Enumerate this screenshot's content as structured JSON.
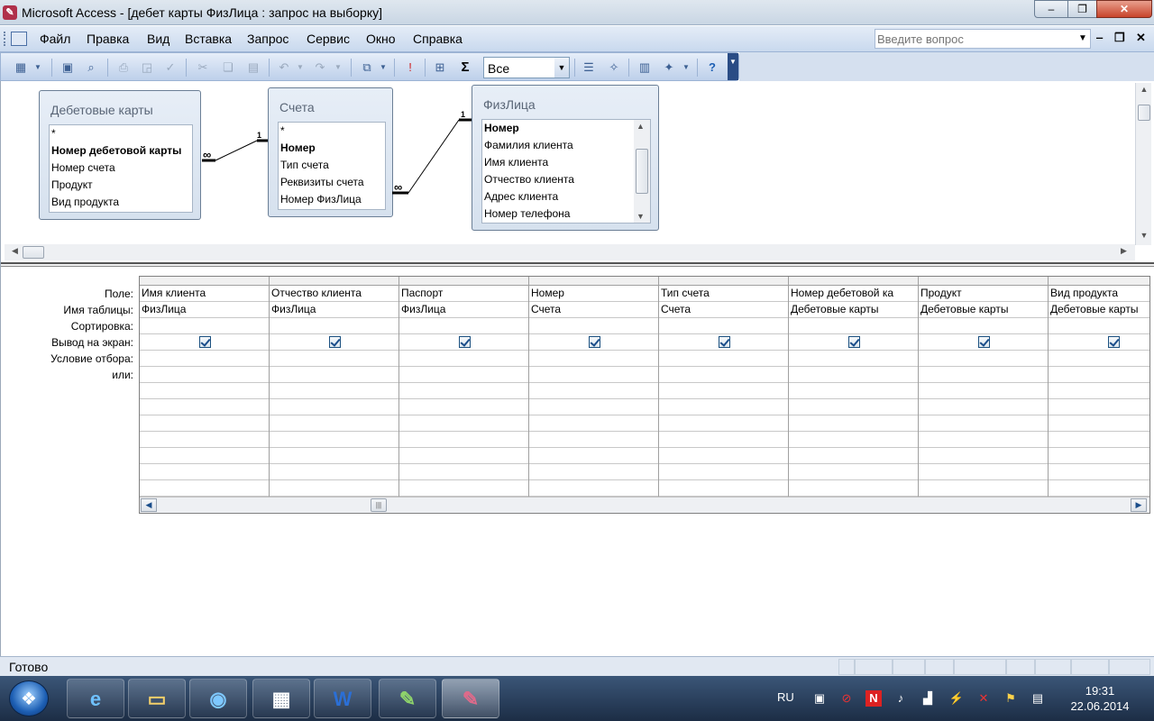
{
  "window": {
    "title": "Microsoft Access - [дебет карты ФизЛица : запрос на выборку]",
    "minimize_glyph": "‒",
    "maximize_glyph": "❐",
    "close_glyph": "✕"
  },
  "menu": {
    "items": [
      "Файл",
      "Правка",
      "Вид",
      "Вставка",
      "Запрос",
      "Сервис",
      "Окно",
      "Справка"
    ],
    "help_placeholder": "Введите вопрос",
    "mdi_minimize": "‒",
    "mdi_restore": "❐",
    "mdi_close": "✕"
  },
  "toolbar": {
    "top_values_combo": "Все",
    "totals_glyph": "Σ"
  },
  "tables": [
    {
      "name": "Дебетовые карты",
      "fields": [
        "*",
        "Номер дебетовой карты",
        "Номер счета",
        "Продукт",
        "Вид продукта"
      ],
      "key_index": 1
    },
    {
      "name": "Счета",
      "fields": [
        "*",
        "Номер",
        "Тип счета",
        "Реквизиты счета",
        "Номер ФизЛица"
      ],
      "key_index": 1
    },
    {
      "name": "ФизЛица",
      "fields": [
        "Номер",
        "Фамилия клиента",
        "Имя клиента",
        "Отчество клиента",
        "Адрес клиента",
        "Номер телефона"
      ],
      "key_index": 0
    }
  ],
  "relationships": {
    "one_label": "1",
    "many_label": "∞"
  },
  "qbe": {
    "row_labels": [
      "Поле:",
      "Имя таблицы:",
      "Сортировка:",
      "Вывод на экран:",
      "Условие отбора:",
      "или:"
    ],
    "columns": [
      {
        "field": "Имя клиента",
        "table": "ФизЛица",
        "show": true
      },
      {
        "field": "Отчество клиента",
        "table": "ФизЛица",
        "show": true
      },
      {
        "field": "Паспорт",
        "table": "ФизЛица",
        "show": true
      },
      {
        "field": "Номер",
        "table": "Счета",
        "show": true
      },
      {
        "field": "Тип счета",
        "table": "Счета",
        "show": true
      },
      {
        "field": "Номер дебетовой ка",
        "table": "Дебетовые карты",
        "show": true
      },
      {
        "field": "Продукт",
        "table": "Дебетовые карты",
        "show": true
      },
      {
        "field": "Вид продукта",
        "table": "Дебетовые карты",
        "show": true
      }
    ]
  },
  "status": {
    "text": "Готово"
  },
  "taskbar": {
    "language": "RU",
    "time": "19:31",
    "date": "22.06.2014"
  }
}
